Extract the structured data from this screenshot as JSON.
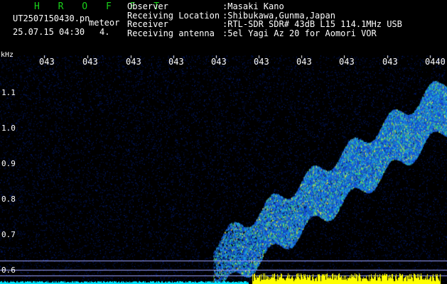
{
  "header": {
    "brand": "H R O F F T",
    "filename": "UT2507150430.pn",
    "meteor_label": "meteor",
    "datetime": "25.07.15 04:30",
    "count": "4."
  },
  "station": [
    {
      "key": "Observer",
      "value": ":Masaki Kano"
    },
    {
      "key": "Receiving Location",
      "value": ":Shibukawa,Gunma,Japan"
    },
    {
      "key": "Receiver",
      "value": ":RTL-SDR SDR# 43dB L15 114.1MHz USB"
    },
    {
      "key": "Receiving antenna",
      "value": ":5el Yagi Az 20 for Aomori VOR"
    }
  ],
  "axes": {
    "y_unit": "kHz",
    "y_ticks": [
      "1.1",
      "1.0",
      "0.9",
      "0.8",
      "0.7",
      "0.6"
    ],
    "x_ticks": [
      "043",
      "043",
      "043",
      "043",
      "043",
      "043",
      "043",
      "043",
      "043",
      "0440"
    ]
  },
  "colors": {
    "background": "#000000",
    "brand": "#1ad21a",
    "noise": "#0a1a7a",
    "signal": "#ffff00",
    "baseline": "#00e5ff"
  }
}
